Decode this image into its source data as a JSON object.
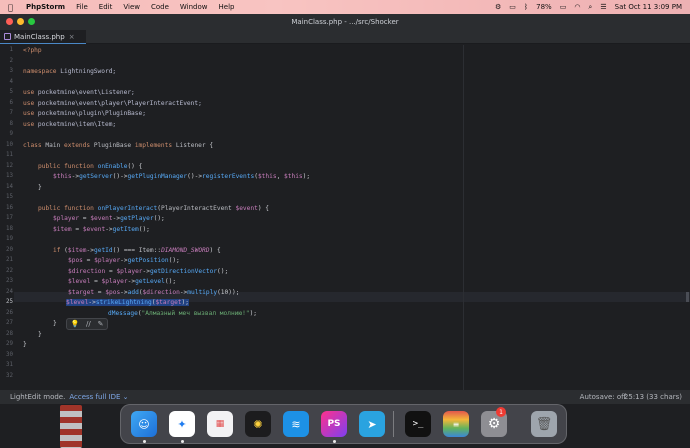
{
  "menubar": {
    "app_name": "PhpStorm",
    "items": [
      "File",
      "Edit",
      "View",
      "Code",
      "Window",
      "Help"
    ],
    "battery": "78%",
    "clock": "Sat Oct 11  3:09 PM"
  },
  "window": {
    "title": "MainClass.php - .../src/Shocker",
    "tab_label": "MainClass.php"
  },
  "editor": {
    "current_line": 25,
    "line_numbers": [
      "1",
      "2",
      "3",
      "4",
      "5",
      "6",
      "7",
      "8",
      "9",
      "10",
      "11",
      "12",
      "13",
      "14",
      "15",
      "16",
      "17",
      "18",
      "19",
      "20",
      "21",
      "22",
      "23",
      "24",
      "25",
      "26",
      "27",
      "28",
      "29",
      "30",
      "31",
      "32"
    ],
    "code": {
      "l1": "<?php",
      "l3_kw": "namespace",
      "l3_ns": "LightningSword;",
      "l5_kw": "use",
      "l5_ns": "pocketmine\\event\\Listener;",
      "l6_kw": "use",
      "l6_ns": "pocketmine\\event\\player\\PlayerInteractEvent;",
      "l7_kw": "use",
      "l7_ns": "pocketmine\\plugin\\PluginBase;",
      "l8_kw": "use",
      "l8_ns": "pocketmine\\item\\Item;",
      "l10_kw1": "class",
      "l10_cls": "Main",
      "l10_kw2": "extends",
      "l10_parent": "PluginBase",
      "l10_kw3": "implements",
      "l10_iface": "Listener",
      "l10_brace": "{",
      "l12_kw": "public function",
      "l12_fn": "onEnable",
      "l12_rest": "() {",
      "l13_var": "$this",
      "l13_a": "->",
      "l13_fn1": "getServer",
      "l13_b": "()->",
      "l13_fn2": "getPluginManager",
      "l13_c": "()->",
      "l13_fn3": "registerEvents",
      "l13_d": "(",
      "l13_var2": "$this",
      "l13_e": ", ",
      "l13_var3": "$this",
      "l13_f": ");",
      "l14": "}",
      "l16_kw": "public function",
      "l16_fn": "onPlayerInteract",
      "l16_a": "(",
      "l16_type": "PlayerInteractEvent",
      "l16_var": "$event",
      "l16_b": ") {",
      "l17_var": "$player",
      "l17_a": " = ",
      "l17_var2": "$event",
      "l17_b": "->",
      "l17_fn": "getPlayer",
      "l17_c": "();",
      "l18_var": "$item",
      "l18_a": " = ",
      "l18_var2": "$event",
      "l18_b": "->",
      "l18_fn": "getItem",
      "l18_c": "();",
      "l20_kw": "if",
      "l20_a": " (",
      "l20_var": "$item",
      "l20_b": "->",
      "l20_fn": "getId",
      "l20_c": "() === ",
      "l20_cls": "Item",
      "l20_d": "::",
      "l20_const": "DIAMOND_SWORD",
      "l20_e": ") {",
      "l21_var": "$pos",
      "l21_a": " = ",
      "l21_var2": "$player",
      "l21_b": "->",
      "l21_fn": "getPosition",
      "l21_c": "();",
      "l22_var": "$direction",
      "l22_a": " = ",
      "l22_var2": "$player",
      "l22_b": "->",
      "l22_fn": "getDirectionVector",
      "l22_c": "();",
      "l23_var": "$level",
      "l23_a": " = ",
      "l23_var2": "$player",
      "l23_b": "->",
      "l23_fn": "getLevel",
      "l23_c": "();",
      "l24_var": "$target",
      "l24_a": " = ",
      "l24_var2": "$pos",
      "l24_b": "->",
      "l24_fn": "add",
      "l24_c": "(",
      "l24_var3": "$direction",
      "l24_d": "->",
      "l24_fn2": "multiply",
      "l24_e": "(10));",
      "l25_var": "$level",
      "l25_a": "->",
      "l25_fn": "strikeLightning",
      "l25_b": "(",
      "l25_var2": "$target",
      "l25_c": ");",
      "l26_fn": "dMessage",
      "l26_a": "(",
      "l26_str": "\"Алмазный меч вызвал молнию!\"",
      "l26_b": ");",
      "l27": "}",
      "l28": "}",
      "l29": "}"
    }
  },
  "inlay_popup": {
    "icons": [
      "lightbulb-icon",
      "comment-icon",
      "edit-icon"
    ],
    "glyphs": [
      "💡",
      "//",
      "✎"
    ]
  },
  "statusbar": {
    "mode": "LightEdit mode.",
    "mode_link": "Access full IDE ⌄",
    "autosave": "Autosave: off",
    "position": "25:13 (33 chars)"
  },
  "dock": {
    "notification_count": "1"
  },
  "colors": {
    "editor_bg": "#1e1f22",
    "keyword": "#cf8e6d",
    "function": "#57aaf7",
    "variable": "#c77dbb",
    "string": "#6aab73"
  }
}
